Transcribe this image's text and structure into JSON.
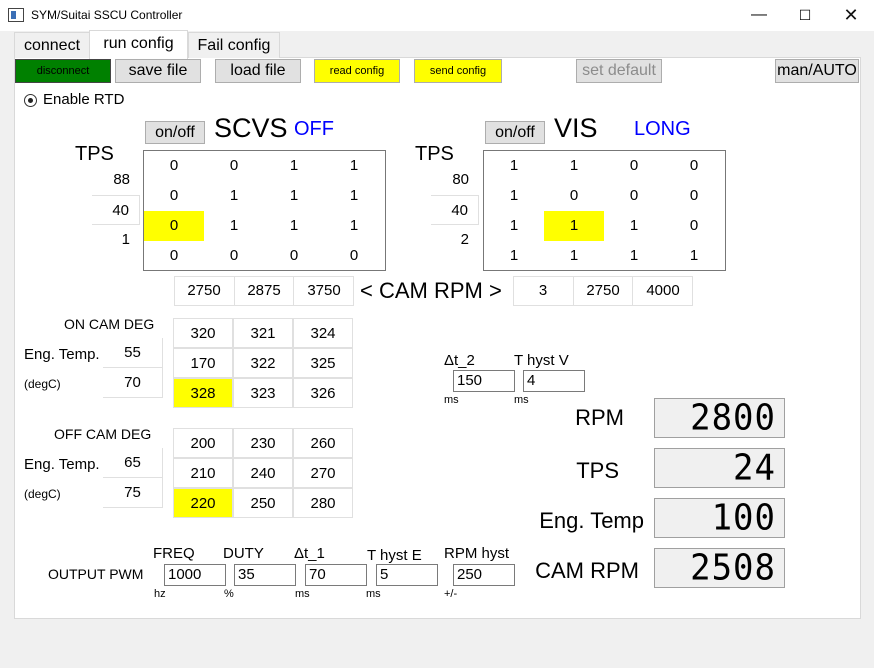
{
  "window": {
    "title": "SYM/Suitai SSCU Controller",
    "minimize_glyph": "—",
    "maximize_glyph": "☐",
    "close_glyph": "✕",
    "icon": "app-window-icon"
  },
  "tabs": [
    "connect",
    "run config",
    "Fail config"
  ],
  "toolbar": {
    "disconnect": "disconnect",
    "save_file": "save file",
    "load_file": "load file",
    "read_config": "read config",
    "send_config": "send config",
    "set_default": "set default",
    "man_auto": "man/AUTO"
  },
  "colors": {
    "accent_yellow": "#ffff00",
    "disconnect_green": "#008000",
    "status_blue": "#0000ff"
  },
  "enable_rtd": "Enable RTD",
  "scvs": {
    "onoff": "on/off",
    "title": "SCVS",
    "status": "OFF",
    "tps_label": "TPS",
    "tps_values": [
      "88",
      "40",
      "1"
    ],
    "rows": [
      [
        "0",
        "0",
        "1",
        "1"
      ],
      [
        "0",
        "1",
        "1",
        "1"
      ],
      [
        "0",
        "1",
        "1",
        "1"
      ],
      [
        "0",
        "0",
        "0",
        "0"
      ]
    ],
    "rpm_values": [
      "2750",
      "2875",
      "3750"
    ]
  },
  "vis": {
    "onoff": "on/off",
    "title": "VIS",
    "status": "LONG",
    "tps_label": "TPS",
    "tps_values": [
      "80",
      "40",
      "2"
    ],
    "rows": [
      [
        "1",
        "1",
        "0",
        "0"
      ],
      [
        "1",
        "0",
        "0",
        "0"
      ],
      [
        "1",
        "1",
        "1",
        "0"
      ],
      [
        "1",
        "1",
        "1",
        "1"
      ]
    ],
    "rpm_values": [
      "3",
      "2750",
      "4000"
    ]
  },
  "cam_rpm_label": "< CAM RPM >",
  "on_cam": {
    "title": "ON CAM DEG",
    "eng_temp_label": "Eng. Temp.",
    "unit": "(degC)",
    "temps": [
      "55",
      "70"
    ],
    "rows": [
      [
        "320",
        "321",
        "324"
      ],
      [
        "170",
        "322",
        "325"
      ],
      [
        "328",
        "323",
        "326"
      ]
    ]
  },
  "off_cam": {
    "title": "OFF CAM DEG",
    "eng_temp_label": "Eng. Temp.",
    "unit": "(degC)",
    "temps": [
      "65",
      "75"
    ],
    "rows": [
      [
        "200",
        "230",
        "260"
      ],
      [
        "210",
        "240",
        "270"
      ],
      [
        "220",
        "250",
        "280"
      ]
    ]
  },
  "timing": {
    "dt2_label": "Δt_2",
    "dt2_value": "150",
    "dt2_unit": "ms",
    "thystv_label": "T hyst V",
    "thystv_value": "4",
    "thystv_unit": "ms"
  },
  "output_pwm": {
    "label": "OUTPUT PWM",
    "freq_label": "FREQ",
    "freq_value": "1000",
    "freq_unit": "hz",
    "duty_label": "DUTY",
    "duty_value": "35",
    "duty_unit": "%",
    "dt1_label": "Δt_1",
    "dt1_value": "70",
    "dt1_unit": "ms",
    "thyste_label": "T hyst E",
    "thyste_value": "5",
    "thyste_unit": "ms",
    "rpmhyst_label": "RPM hyst",
    "rpmhyst_value": "250",
    "rpmhyst_unit": "+/-"
  },
  "gauges": [
    {
      "label": "RPM",
      "value": "2800"
    },
    {
      "label": "TPS",
      "value": "24"
    },
    {
      "label": "Eng. Temp",
      "value": "100"
    },
    {
      "label": "CAM RPM",
      "value": "2508"
    }
  ]
}
